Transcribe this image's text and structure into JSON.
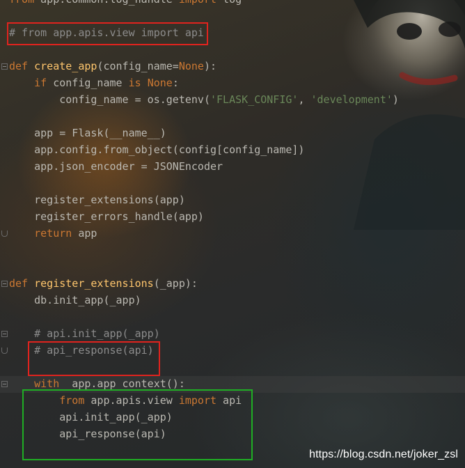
{
  "colors": {
    "keyword": "#cc7832",
    "function": "#ffc66d",
    "string": "#6a8759",
    "comment": "#8c8c8c",
    "text": "#bbb9b2",
    "annotation_red": "#e0231e",
    "annotation_green": "#1fae24"
  },
  "code": {
    "l0": {
      "kw_from": "from",
      "mod": " app.common.log_handle ",
      "kw_import": "import",
      "name": " log"
    },
    "l2": {
      "comment": "# from app.apis.view import api"
    },
    "l4": {
      "kw_def": "def",
      "sp": " ",
      "fn": "create_app",
      "args_open": "(config_name=",
      "none": "None",
      "args_close": "):"
    },
    "l5": {
      "indent": "    ",
      "kw_if": "if",
      "mid": " config_name ",
      "kw_is": "is",
      "sp": " ",
      "none": "None",
      "colon": ":"
    },
    "l6": {
      "indent": "        ",
      "pre": "config_name = os.getenv(",
      "str1": "'FLASK_CONFIG'",
      "comma": ", ",
      "str2": "'development'",
      "close": ")"
    },
    "l8": {
      "text": "    app = Flask(__name__)"
    },
    "l9": {
      "text": "    app.config.from_object(config[config_name])"
    },
    "l10": {
      "text": "    app.json_encoder = JSONEncoder"
    },
    "l12": {
      "text": "    register_extensions(app)"
    },
    "l13": {
      "text": "    register_errors_handle(app)"
    },
    "l14": {
      "indent": "    ",
      "kw_return": "return",
      "rest": " app"
    },
    "l17": {
      "kw_def": "def",
      "sp": " ",
      "fn": "register_extensions",
      "args": "(_app):"
    },
    "l18": {
      "text": "    db.init_app(_app)"
    },
    "l20": {
      "indent": "    ",
      "comment": "# api.init_app(_app)"
    },
    "l21": {
      "indent": "    ",
      "comment": "# api_response(api)"
    },
    "l23": {
      "indent": "    ",
      "kw_with": "with",
      "rest": " _app.app_context():"
    },
    "l24": {
      "indent": "        ",
      "kw_from": "from",
      "mod": " app.apis.view ",
      "kw_import": "import",
      "name": " api"
    },
    "l25": {
      "text": "        api.init_app(_app)"
    },
    "l26": {
      "text": "        api_response(api)"
    }
  },
  "watermark": "https://blog.csdn.net/joker_zsl"
}
